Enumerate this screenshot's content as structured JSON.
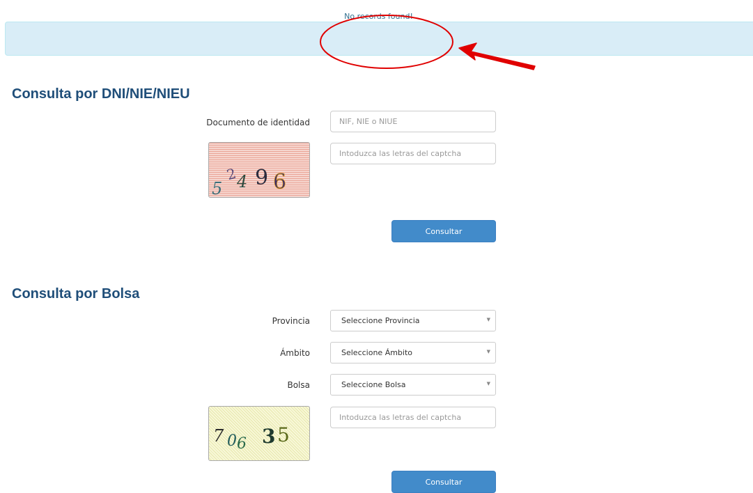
{
  "alert": {
    "message": "No records found!"
  },
  "annotation": {
    "color": "#e00000"
  },
  "dni_section": {
    "title": "Consulta por DNI/NIE/NIEU",
    "document_label": "Documento de identidad",
    "document_placeholder": "NIF, NIE o NIUE",
    "captcha_placeholder": "Intoduzca las letras del captcha",
    "submit_label": "Consultar"
  },
  "bolsa_section": {
    "title": "Consulta por Bolsa",
    "provincia_label": "Provincia",
    "provincia_selected": "Seleccione Provincia",
    "ambito_label": "Ámbito",
    "ambito_selected": "Seleccione Ámbito",
    "bolsa_label": "Bolsa",
    "bolsa_selected": "Seleccione Bolsa",
    "captcha_placeholder": "Intoduzca las letras del captcha",
    "submit_label": "Consultar"
  },
  "theme": {
    "alert_bg": "#d9edf7",
    "alert_text": "#31708f",
    "title_color": "#1f4e79",
    "button_bg": "#428bca"
  }
}
